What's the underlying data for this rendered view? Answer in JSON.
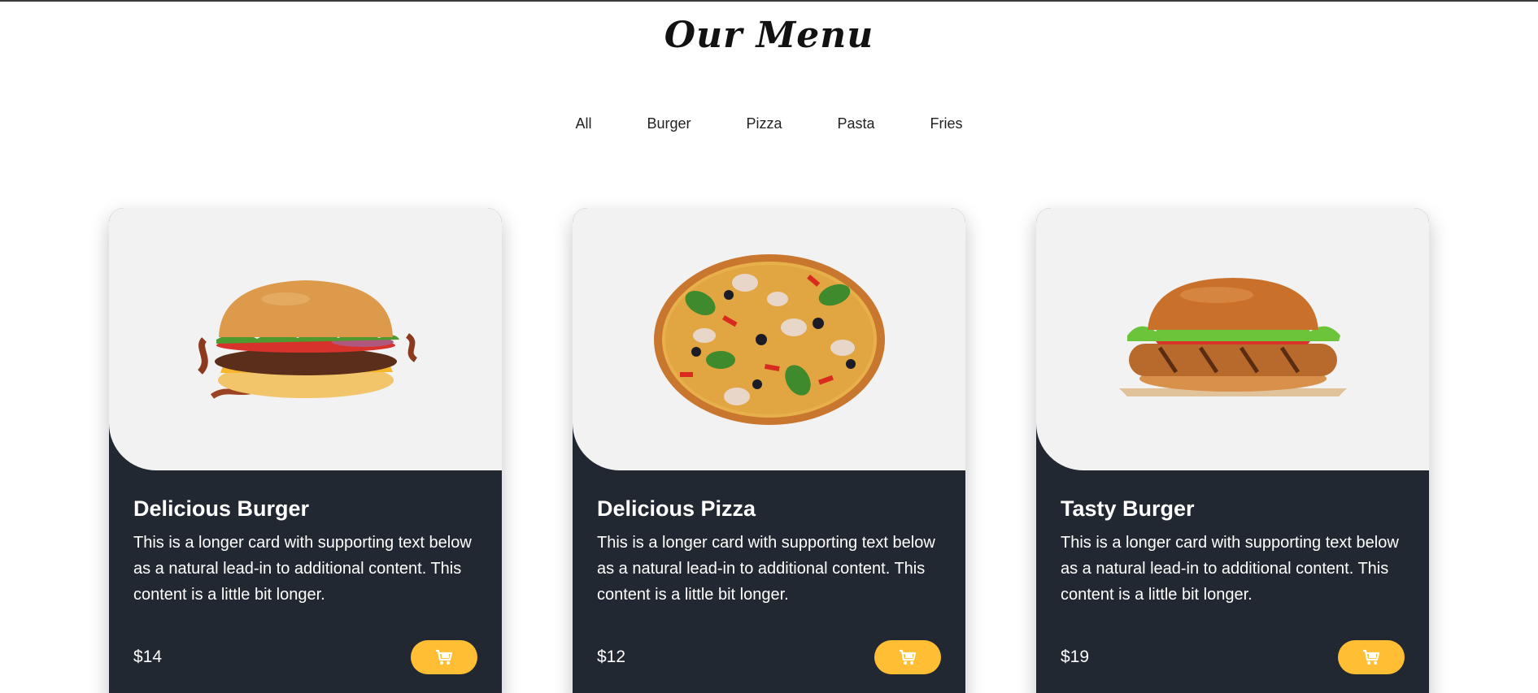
{
  "heading": "Our Menu",
  "filters": [
    "All",
    "Burger",
    "Pizza",
    "Pasta",
    "Fries"
  ],
  "colors": {
    "card_dark": "#222831",
    "accent": "#ffbe33",
    "image_bg": "#f2f2f2"
  },
  "cards": [
    {
      "title": "Delicious Burger",
      "text": "This is a longer card with supporting text below as a natural lead-in to additional content. This content is a little bit longer.",
      "price": "$14",
      "image": "burger-image",
      "cart_icon": "cart-icon"
    },
    {
      "title": "Delicious Pizza",
      "text": "This is a longer card with supporting text below as a natural lead-in to additional content. This content is a little bit longer.",
      "price": "$12",
      "image": "pizza-image",
      "cart_icon": "cart-icon"
    },
    {
      "title": "Tasty Burger",
      "text": "This is a longer card with supporting text below as a natural lead-in to additional content. This content is a little bit longer.",
      "price": "$19",
      "image": "chicken-burger-image",
      "cart_icon": "cart-icon"
    }
  ]
}
